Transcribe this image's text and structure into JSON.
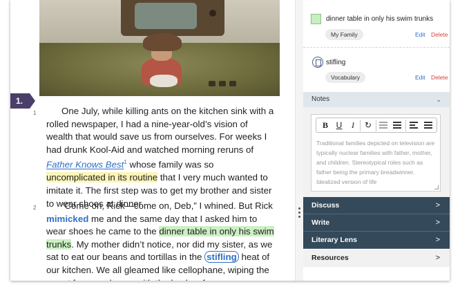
{
  "reader": {
    "section_number": "1.",
    "paragraphs": [
      {
        "number": "1",
        "t1": "One July, while killing ants on the kitchen sink with a rolled newspaper, I had a nine-year-old’s vision of wealth that would save us from ourselves. For weeks I had drunk Kool-Aid and watched morning reruns of ",
        "link": "Father Knows Best",
        "footnote": "1",
        "t2": " whose family was so ",
        "highlight": "uncomplicated in its routine",
        "t3": " that I very much wanted to imitate it. The first step was to get my brother and sister to wear shoes at dinner."
      },
      {
        "number": "2",
        "t1": "“Come on, Rick—come on, Deb,” I whined. But Rick ",
        "vocab": "mimicked",
        "t2": " me and the same day that I asked him to wear shoes he came to the ",
        "highlight": "dinner table in only his swim trunks",
        "t3": ". My mother didn’t notice, nor did my sister, as we sat to eat our beans and tortillas in the ",
        "vocab2": "stifling",
        "t4": " heat of our kitchen. We all gleamed like cellophane, wiping the sweat from our brows with the backs of"
      }
    ]
  },
  "side": {
    "cards": [
      {
        "title": "dinner table in only his swim trunks",
        "tag": "My Family",
        "edit": "Edit",
        "delete": "Delete",
        "swatch_color": "#c7efc1"
      },
      {
        "title": "stifling",
        "tag": "Vocabulary",
        "edit": "Edit",
        "delete": "Delete",
        "icon": "document-icon"
      }
    ],
    "notes": {
      "header": "Notes",
      "toolbar": {
        "bold": "B",
        "underline": "U",
        "italic": "I"
      },
      "text": "Traditional families depicted on television are typically nuclear families with father, mother, and children.  Stereotypical roles such as father being the primary breadwinner.  Idealized version of life"
    },
    "sections": [
      {
        "label": "Discuss",
        "arrow": ">"
      },
      {
        "label": "Write",
        "arrow": ">"
      },
      {
        "label": "Literary Lens",
        "arrow": ">"
      },
      {
        "label": "Resources",
        "arrow": ">"
      }
    ],
    "colors": {
      "dark_section": "#34495a",
      "link_blue": "#2f6ec6",
      "delete_red": "#d8433b"
    }
  }
}
